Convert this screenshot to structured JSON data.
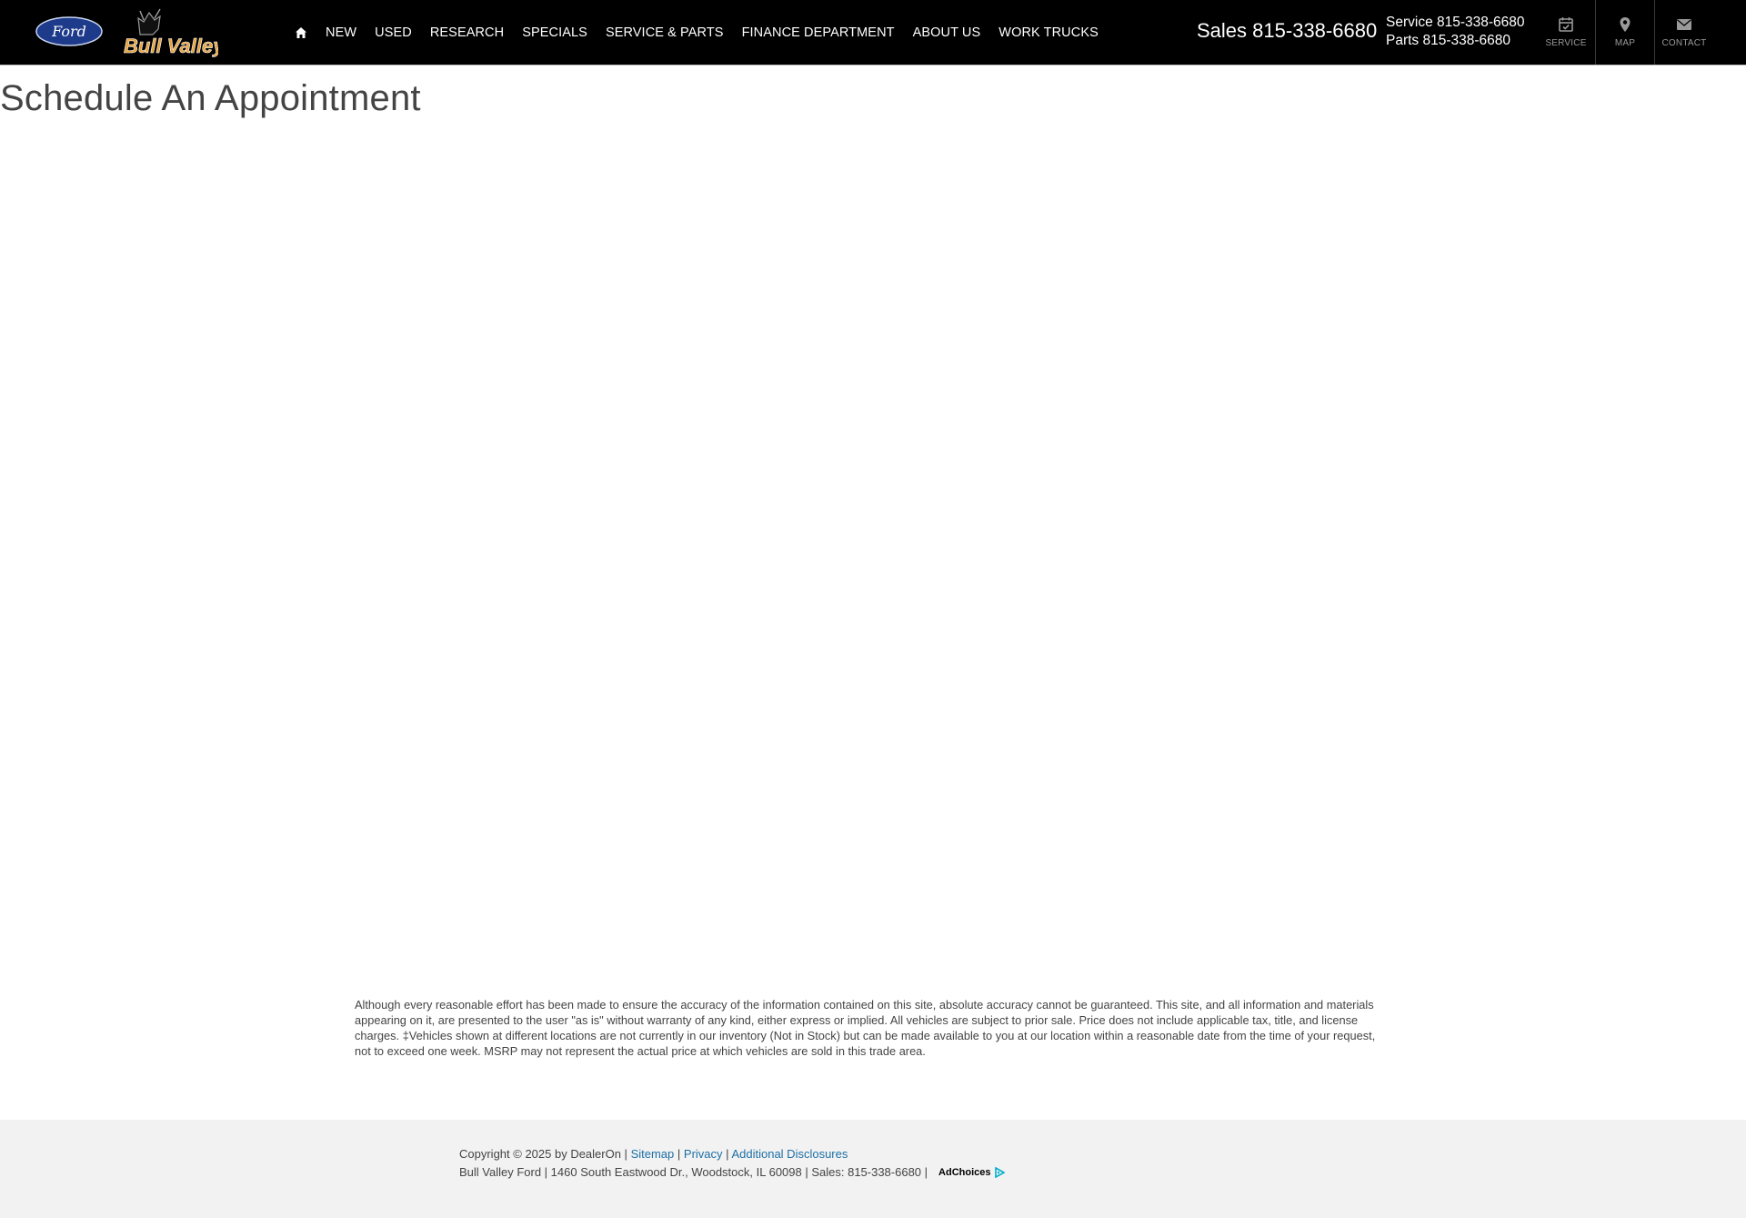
{
  "header": {
    "brand_logo_text": "Ford",
    "dealer_logo_text": "Bull Valley",
    "nav": [
      "NEW",
      "USED",
      "RESEARCH",
      "SPECIALS",
      "SERVICE & PARTS",
      "FINANCE DEPARTMENT",
      "ABOUT US",
      "WORK TRUCKS"
    ],
    "sales_label": "Sales",
    "sales_phone": "815-338-6680",
    "service_label": "Service",
    "service_phone": "815-338-6680",
    "parts_label": "Parts",
    "parts_phone": "815-338-6680",
    "icons": [
      {
        "label": "SERVICE",
        "icon": "calendar-check-icon"
      },
      {
        "label": "MAP",
        "icon": "map-pin-icon"
      },
      {
        "label": "CONTACT",
        "icon": "envelope-icon"
      }
    ]
  },
  "main": {
    "title": "Schedule An Appointment"
  },
  "disclaimer": "Although every reasonable effort has been made to ensure the accuracy of the information contained on this site, absolute accuracy cannot be guaranteed. This site, and all information and materials appearing on it, are presented to the user \"as is\" without warranty of any kind, either express or implied. All vehicles are subject to prior sale. Price does not include applicable tax, title, and license charges. ‡Vehicles shown at different locations are not currently in our inventory (Not in Stock) but can be made available to you at our location within a reasonable date from the time of your request, not to exceed one week. MSRP may not represent the actual price at which vehicles are sold in this trade area.",
  "footer": {
    "copyright": "Copyright © 2025 by DealerOn |",
    "sitemap": "Sitemap",
    "privacy": "Privacy",
    "additional": "Additional Disclosures",
    "sep": "|",
    "address": "Bull Valley Ford | 1460 South Eastwood Dr., Woodstock, IL 60098 | Sales: 815-338-6680 |",
    "adchoices": "AdChoices"
  },
  "colors": {
    "header_bg": "#000000",
    "link": "#1d6fa5",
    "footer_bg": "#f2f2f2",
    "bull_orange": "#e8a33a"
  }
}
